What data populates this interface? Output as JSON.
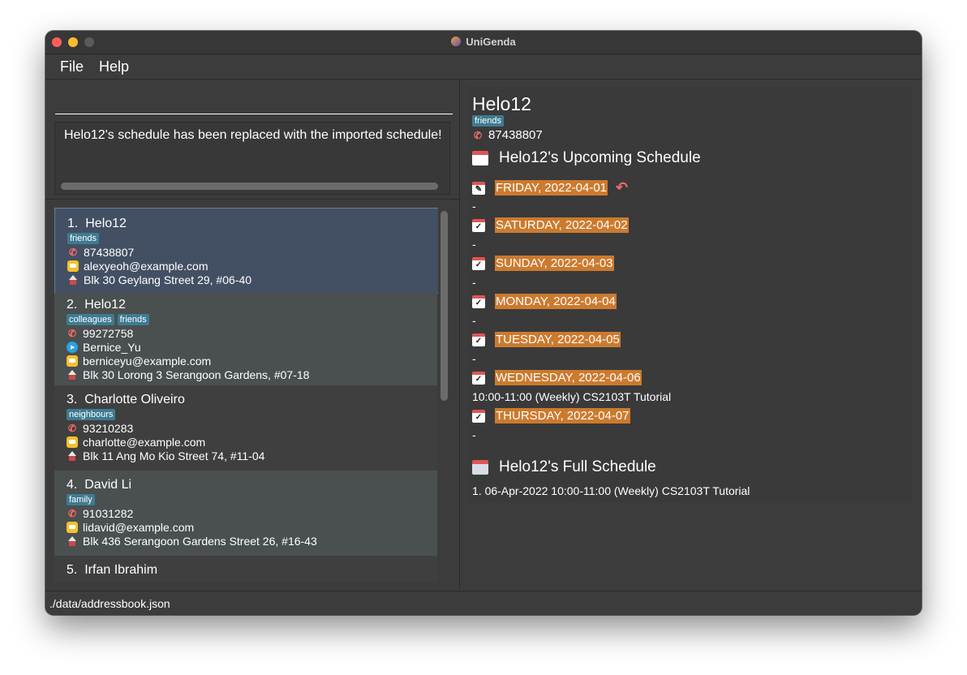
{
  "window": {
    "title": "UniGenda"
  },
  "menu": {
    "file": "File",
    "help": "Help"
  },
  "command": {
    "value": ""
  },
  "result": {
    "message": "Helo12's schedule has been replaced with the imported schedule!"
  },
  "persons": [
    {
      "index": "1.",
      "name": "Helo12",
      "tags": [
        "friends"
      ],
      "phone": "87438807",
      "telegram": "",
      "email": "alexyeoh@example.com",
      "address": "Blk 30 Geylang Street 29, #06-40"
    },
    {
      "index": "2.",
      "name": "Helo12",
      "tags": [
        "colleagues",
        "friends"
      ],
      "phone": "99272758",
      "telegram": "Bernice_Yu",
      "email": "berniceyu@example.com",
      "address": "Blk 30 Lorong 3 Serangoon Gardens, #07-18"
    },
    {
      "index": "3.",
      "name": "Charlotte Oliveiro",
      "tags": [
        "neighbours"
      ],
      "phone": "93210283",
      "telegram": "",
      "email": "charlotte@example.com",
      "address": "Blk 11 Ang Mo Kio Street 74, #11-04"
    },
    {
      "index": "4.",
      "name": "David Li",
      "tags": [
        "family"
      ],
      "phone": "91031282",
      "telegram": "",
      "email": "lidavid@example.com",
      "address": "Blk 436 Serangoon Gardens Street 26, #16-43"
    },
    {
      "index": "5.",
      "name": "Irfan Ibrahim",
      "tags": [],
      "phone": "",
      "telegram": "",
      "email": "",
      "address": ""
    }
  ],
  "detail": {
    "name": "Helo12",
    "tag": "friends",
    "phone": "87438807",
    "upcoming_title": "Helo12's Upcoming Schedule",
    "days": [
      {
        "label": "FRIDAY, 2022-04-01",
        "entry": "-"
      },
      {
        "label": "SATURDAY, 2022-04-02",
        "entry": "-"
      },
      {
        "label": "SUNDAY, 2022-04-03",
        "entry": "-"
      },
      {
        "label": "MONDAY, 2022-04-04",
        "entry": "-"
      },
      {
        "label": "TUESDAY, 2022-04-05",
        "entry": "-"
      },
      {
        "label": "WEDNESDAY, 2022-04-06",
        "entry": "10:00-11:00 (Weekly) CS2103T Tutorial"
      },
      {
        "label": "THURSDAY, 2022-04-07",
        "entry": "-"
      }
    ],
    "full_title": "Helo12's Full Schedule",
    "full_entries": [
      "1. 06-Apr-2022 10:00-11:00 (Weekly) CS2103T Tutorial"
    ]
  },
  "status": {
    "path": "./data/addressbook.json"
  },
  "colors": {
    "day_highlight": "#cc7a2e",
    "tag": "#3e7b91",
    "selected_card": "#435063"
  }
}
